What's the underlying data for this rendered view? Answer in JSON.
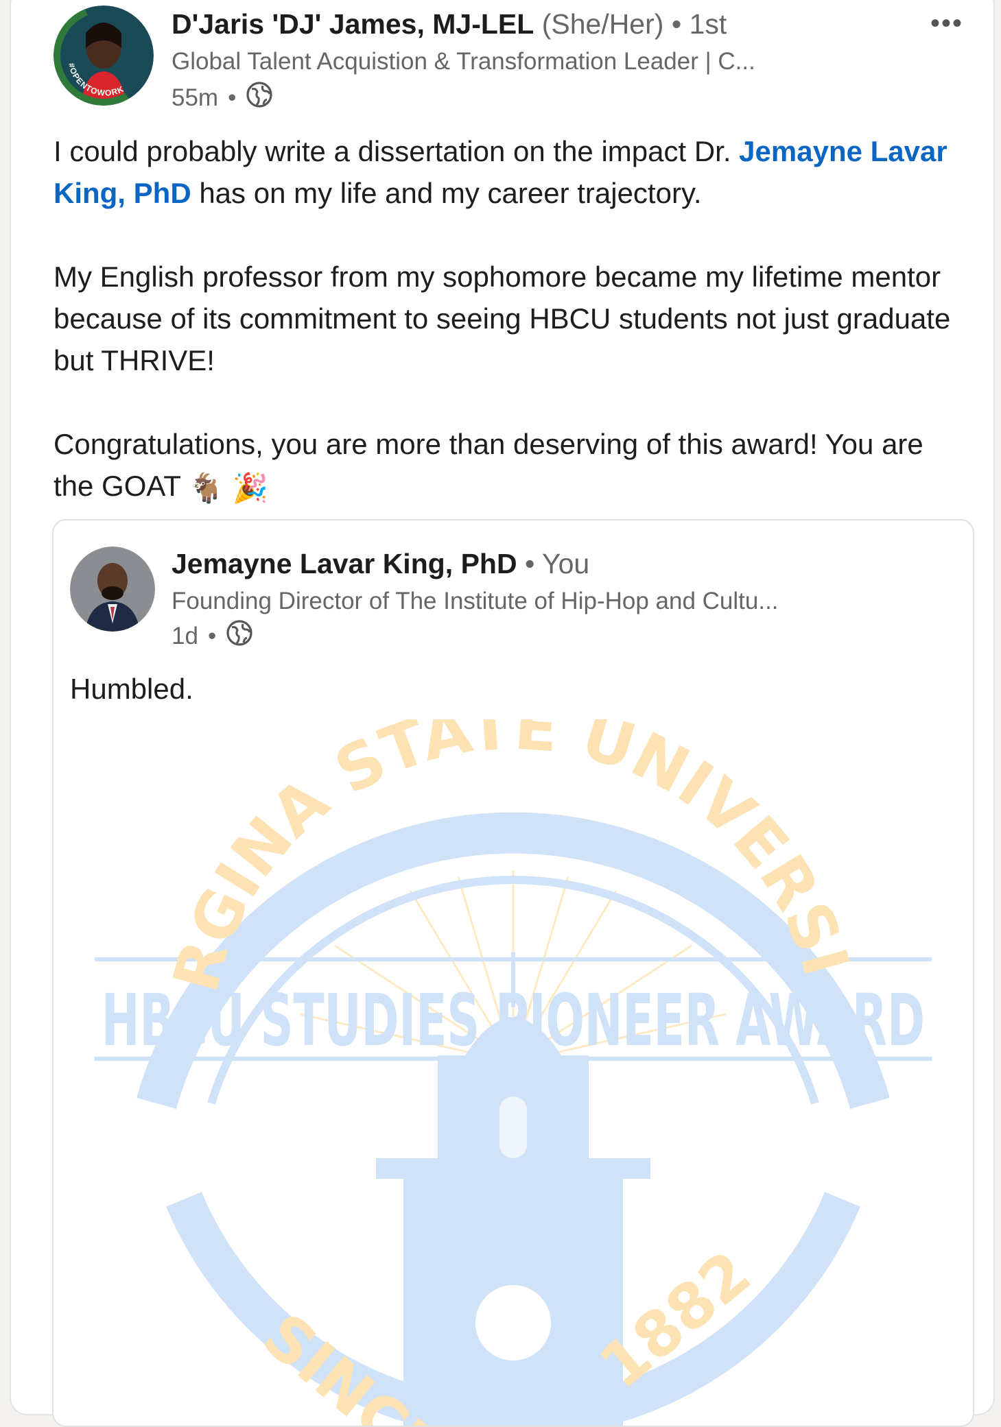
{
  "post": {
    "author_name": "D'Jaris 'DJ' James, MJ-LEL",
    "pronouns": "(She/Her)",
    "connection": "1st",
    "headline": "Global Talent Acquistion & Transformation Leader | C...",
    "time": "55m",
    "visibility_icon": "globe-icon",
    "avatar_badge": "#OPENTOWORK",
    "body": {
      "p1_before": "I could probably write a dissertation on the impact Dr. ",
      "mention": "Jemayne Lavar King, PhD",
      "p1_after": " has on my life and my career trajectory.",
      "p2": "My English professor from my sophomore became my lifetime mentor because of its commitment to seeing HBCU students not just graduate but THRIVE!",
      "p3": "Congratulations, you are more than deserving of this award! You are the GOAT",
      "emojis": [
        "🐐",
        "🎉"
      ]
    }
  },
  "shared_post": {
    "author_name": "Jemayne Lavar King, PhD",
    "relation": "You",
    "headline": "Founding Director of The Institute of Hip-Hop and Cultu...",
    "time": "1d",
    "text": "Humbled."
  },
  "award_image": {
    "arc_top": "VIRGINA STATE UNIVERSITY",
    "banner": "HBCU STUDIES PIONEER AWARD",
    "since": "SINCE",
    "year": "1882"
  },
  "colors": {
    "link": "#0a66c2",
    "award_blue": "#cfe2f8",
    "award_gold": "#fde3b4",
    "opentowork_green": "#2f7a3a"
  }
}
